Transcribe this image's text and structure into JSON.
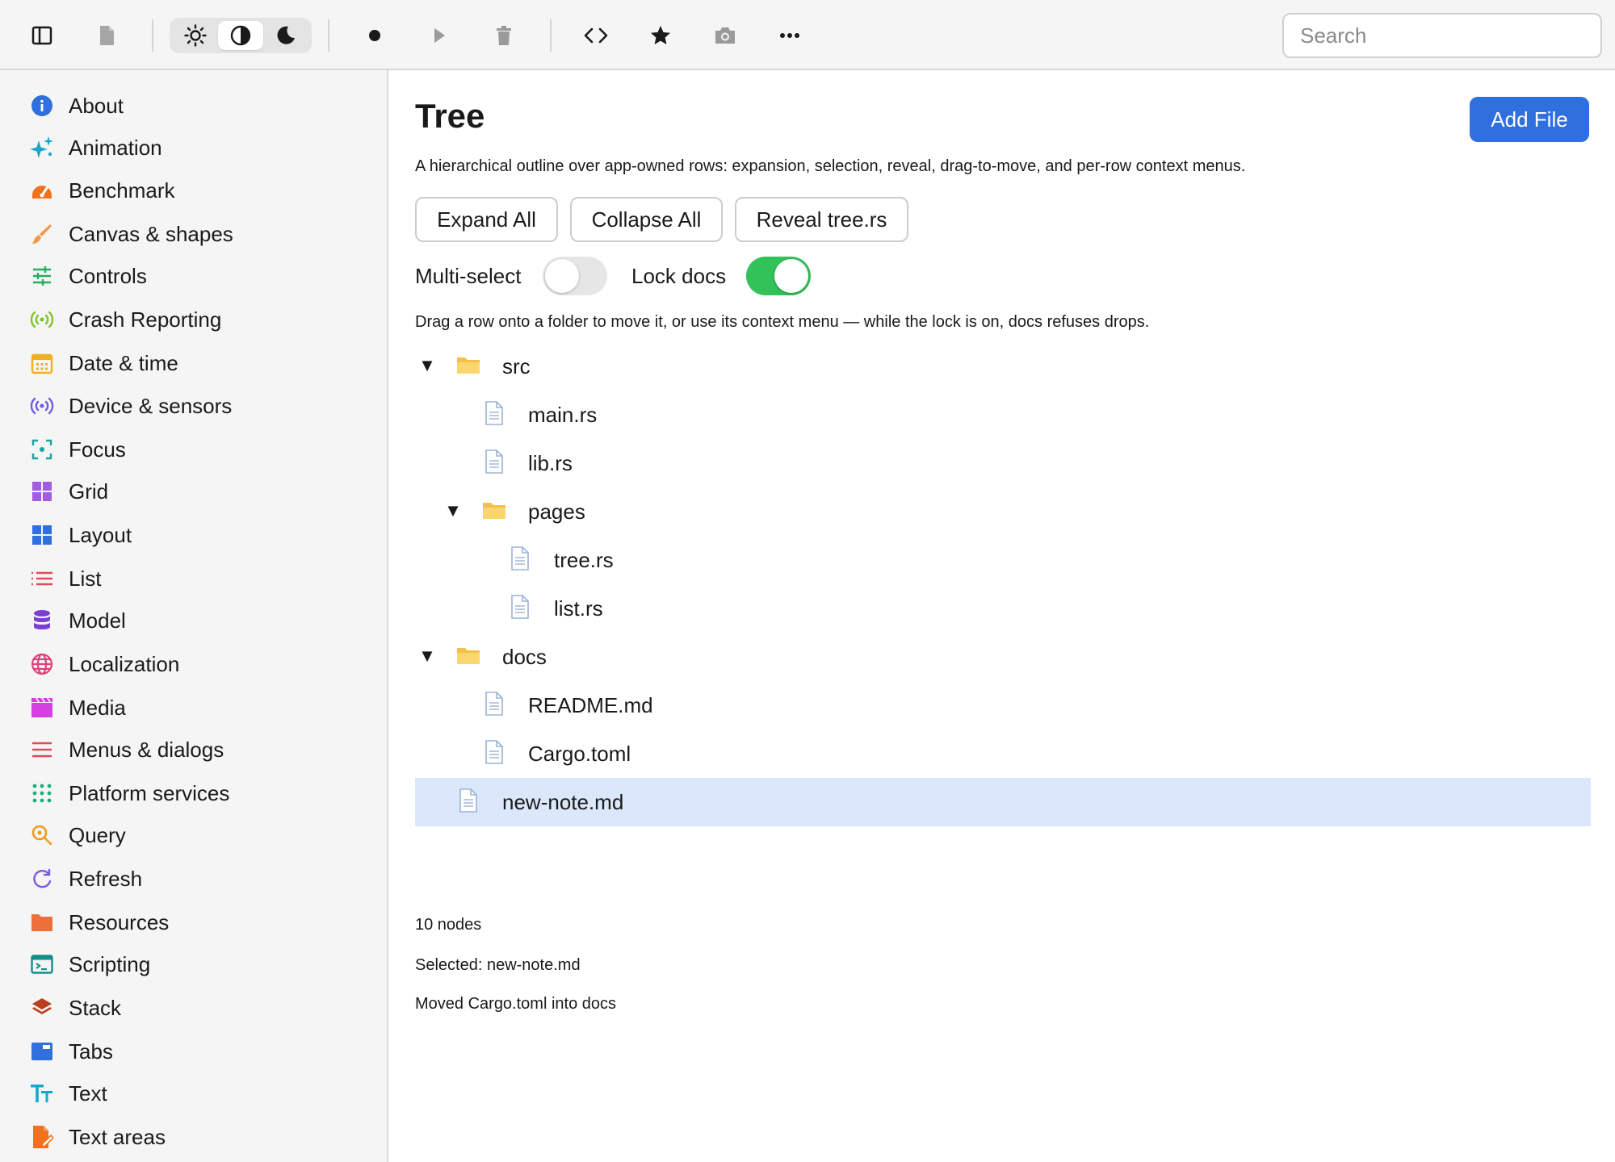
{
  "toolbar": {
    "sidebar_toggle_icon": "sidebar-icon",
    "document_icon": "document-icon",
    "theme_options": [
      "sun-icon",
      "contrast-icon",
      "moon-icon"
    ],
    "theme_selected": "contrast-icon",
    "record_icon": "record-icon",
    "play_icon": "play-icon",
    "trash_icon": "trash-icon",
    "code_icon": "code-icon",
    "star_icon": "star-icon",
    "camera_icon": "camera-icon",
    "more_icon": "more-icon",
    "search_placeholder": "Search",
    "search_value": ""
  },
  "sidebar": {
    "items": [
      {
        "label": "About",
        "icon": "info-icon",
        "color": "#2f6fde"
      },
      {
        "label": "Animation",
        "icon": "sparkles-icon",
        "color": "#17a8c9"
      },
      {
        "label": "Benchmark",
        "icon": "gauge-icon",
        "color": "#f2711c"
      },
      {
        "label": "Canvas & shapes",
        "icon": "brush-icon",
        "color": "#f2994a"
      },
      {
        "label": "Controls",
        "icon": "sliders-icon",
        "color": "#27ae60"
      },
      {
        "label": "Crash Reporting",
        "icon": "broadcast-icon",
        "color": "#7cc42a"
      },
      {
        "label": "Date & time",
        "icon": "calendar-icon",
        "color": "#f2b01e"
      },
      {
        "label": "Device & sensors",
        "icon": "sensor-icon",
        "color": "#6b5be6"
      },
      {
        "label": "Focus",
        "icon": "focus-icon",
        "color": "#16a5a0"
      },
      {
        "label": "Grid",
        "icon": "grid-icon",
        "color": "#a35de0"
      },
      {
        "label": "Layout",
        "icon": "layout-icon",
        "color": "#2f6fde"
      },
      {
        "label": "List",
        "icon": "list-icon",
        "color": "#e04a5a"
      },
      {
        "label": "Model",
        "icon": "database-icon",
        "color": "#7a3fd4"
      },
      {
        "label": "Localization",
        "icon": "globe-icon",
        "color": "#e0407a"
      },
      {
        "label": "Media",
        "icon": "clapper-icon",
        "color": "#d63fe0"
      },
      {
        "label": "Menus & dialogs",
        "icon": "menu-icon",
        "color": "#e04a5a"
      },
      {
        "label": "Platform services",
        "icon": "dots-grid-icon",
        "color": "#1fae7a"
      },
      {
        "label": "Query",
        "icon": "search-icon",
        "color": "#f29a1e"
      },
      {
        "label": "Refresh",
        "icon": "refresh-icon",
        "color": "#7a5be0"
      },
      {
        "label": "Resources",
        "icon": "folder-icon",
        "color": "#ef6f3a"
      },
      {
        "label": "Scripting",
        "icon": "terminal-icon",
        "color": "#138f8a"
      },
      {
        "label": "Stack",
        "icon": "layers-icon",
        "color": "#b8401e"
      },
      {
        "label": "Tabs",
        "icon": "tabs-icon",
        "color": "#2f6fde"
      },
      {
        "label": "Text",
        "icon": "text-icon",
        "color": "#17a8c9"
      },
      {
        "label": "Text areas",
        "icon": "edit-file-icon",
        "color": "#f2711c"
      }
    ]
  },
  "main": {
    "title": "Tree",
    "add_button": "Add File",
    "description": "A hierarchical outline over app-owned rows: expansion, selection, reveal, drag-to-move, and per-row context menus.",
    "buttons": {
      "expand_all": "Expand All",
      "collapse_all": "Collapse All",
      "reveal": "Reveal tree.rs"
    },
    "toggles": {
      "multi_select": {
        "label": "Multi-select",
        "on": false
      },
      "lock_docs": {
        "label": "Lock docs",
        "on": true
      }
    },
    "hint": "Drag a row onto a folder to move it, or use its context menu — while the lock is on, docs refuses drops.",
    "tree": [
      {
        "label": "src",
        "type": "folder",
        "depth": 0,
        "expanded": true
      },
      {
        "label": "main.rs",
        "type": "file",
        "depth": 1
      },
      {
        "label": "lib.rs",
        "type": "file",
        "depth": 1
      },
      {
        "label": "pages",
        "type": "folder",
        "depth": 1,
        "expanded": true
      },
      {
        "label": "tree.rs",
        "type": "file",
        "depth": 2
      },
      {
        "label": "list.rs",
        "type": "file",
        "depth": 2
      },
      {
        "label": "docs",
        "type": "folder",
        "depth": 0,
        "expanded": true
      },
      {
        "label": "README.md",
        "type": "file",
        "depth": 1
      },
      {
        "label": "Cargo.toml",
        "type": "file",
        "depth": 1
      },
      {
        "label": "new-note.md",
        "type": "file",
        "depth": 0,
        "selected": true
      }
    ],
    "disclosure_glyph": "▼",
    "status": {
      "node_count": "10 nodes",
      "selected": "Selected: new-note.md",
      "last_action": "Moved Cargo.toml into docs"
    },
    "colors": {
      "accent": "#2f6fde",
      "toggle_on": "#33c159",
      "selection": "#dbe7fb"
    }
  }
}
